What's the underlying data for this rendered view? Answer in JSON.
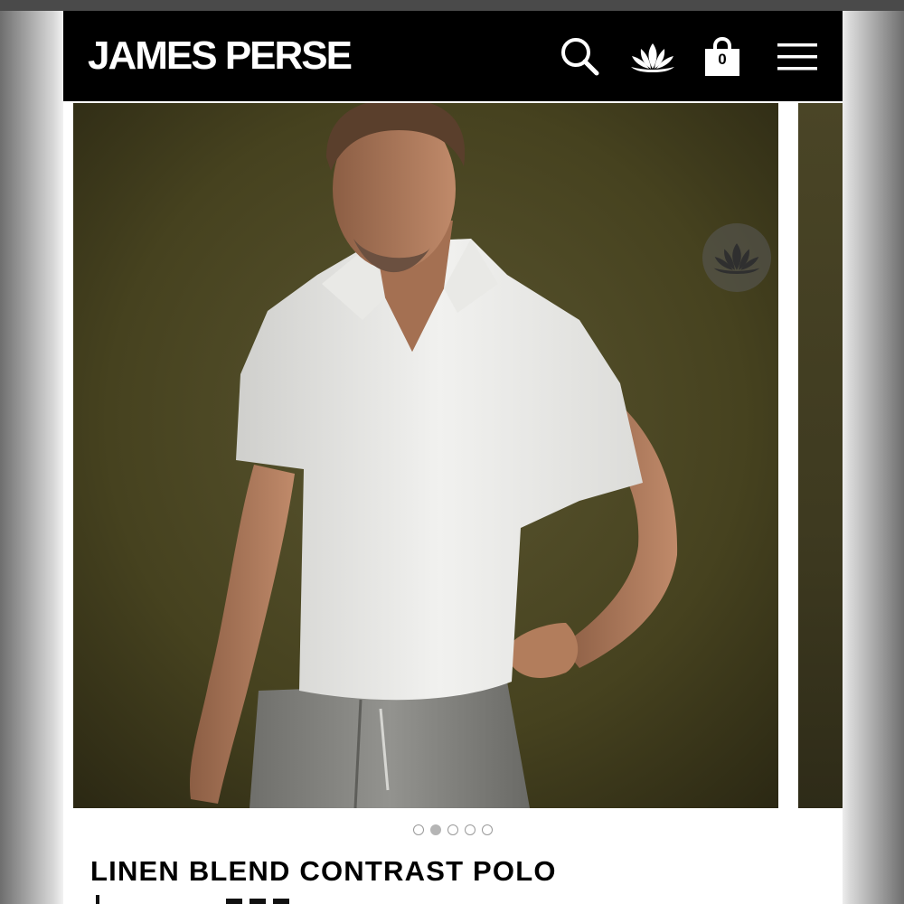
{
  "brand": {
    "logo_text": "JAMES PERSE"
  },
  "header": {
    "search_icon": "search-icon",
    "lotus_icon": "lotus-icon",
    "bag_icon": "shopping-bag-icon",
    "bag_count": "0",
    "menu_icon": "hamburger-menu-icon"
  },
  "gallery": {
    "image_count": 5,
    "active_index": 1,
    "favorite_icon": "lotus-icon"
  },
  "product": {
    "title": "LINEN BLEND CONTRAST POLO"
  },
  "colors": {
    "header_bg": "#000000",
    "backdrop": "#4a4526",
    "shirt": "#e8e8e6",
    "pants": "#8a8a86"
  }
}
